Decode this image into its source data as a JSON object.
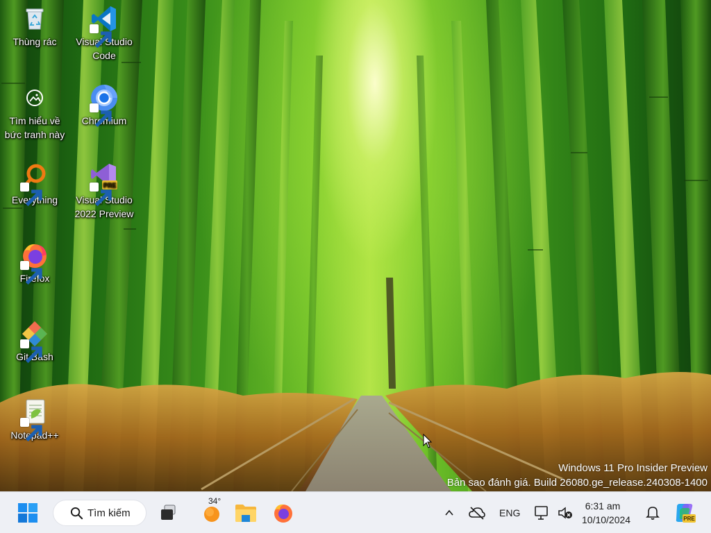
{
  "desktop": {
    "icons": [
      {
        "label": "Thùng rác",
        "icon": "recycle-bin-icon"
      },
      {
        "label": "Visual Studio Code",
        "icon": "vscode-icon"
      },
      {
        "label": "Tìm hiểu về bức tranh này",
        "icon": "learn-about-picture-icon"
      },
      {
        "label": "Chromium",
        "icon": "chromium-icon"
      },
      {
        "label": "Everything",
        "icon": "everything-search-icon"
      },
      {
        "label": "Visual Studio 2022 Preview",
        "icon": "visual-studio-preview-icon"
      },
      {
        "label": "Firefox",
        "icon": "firefox-icon"
      },
      {
        "label": "Git Bash",
        "icon": "git-bash-icon"
      },
      {
        "label": "Notepad++",
        "icon": "notepadpp-icon"
      }
    ],
    "vs_badge": "PRE"
  },
  "watermark": {
    "line1": "Windows 11 Pro Insider Preview",
    "line2": "Bản sao đánh giá. Build 26080.ge_release.240308-1400"
  },
  "taskbar": {
    "search_label": "Tìm kiếm",
    "weather_temp": "34°",
    "language": "ENG",
    "time": "6:31 am",
    "date": "10/10/2024",
    "copilot_badge": "PRE",
    "accent": "#0078d4"
  }
}
